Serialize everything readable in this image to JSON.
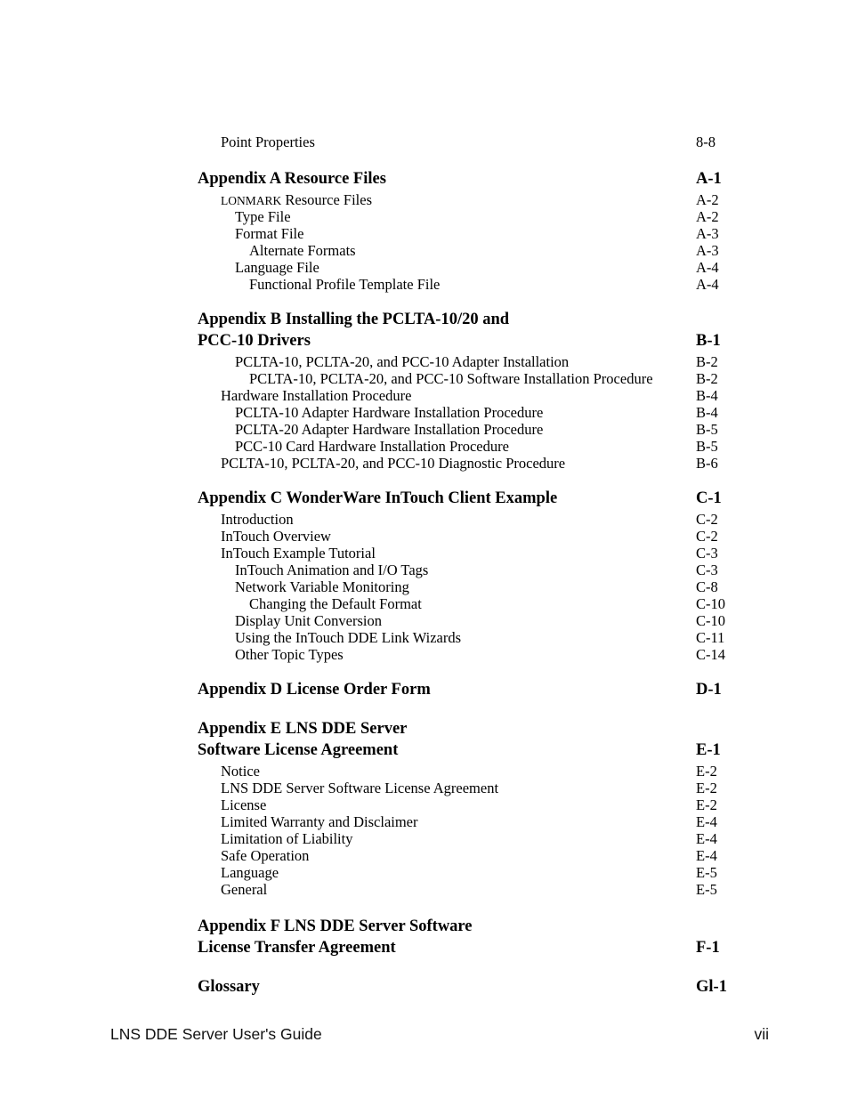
{
  "document": {
    "footer_left": "LNS DDE Server User's Guide",
    "footer_right": "vii"
  },
  "toc": {
    "entries": [
      {
        "level": 1,
        "type": "entry",
        "label": "Point Properties",
        "page": "8-8",
        "gap_before": 0
      },
      {
        "level": 0,
        "type": "head",
        "label": "Appendix A  Resource Files",
        "page": "A-1",
        "gap_before": 20
      },
      {
        "level": 1,
        "type": "entry",
        "label": "LONMARK Resource Files",
        "page": "A-2",
        "gap_before": 2,
        "smallcaps_prefix": "LONMARK",
        "rest": " Resource Files"
      },
      {
        "level": 2,
        "type": "entry",
        "label": "Type File",
        "page": "A-2",
        "gap_before": 0
      },
      {
        "level": 2,
        "type": "entry",
        "label": "Format File",
        "page": "A-3",
        "gap_before": 0
      },
      {
        "level": 3,
        "type": "entry",
        "label": "Alternate Formats",
        "page": "A-3",
        "gap_before": 0
      },
      {
        "level": 2,
        "type": "entry",
        "label": "Language File",
        "page": "A-4",
        "gap_before": 0
      },
      {
        "level": 3,
        "type": "entry",
        "label": "Functional Profile Template File",
        "page": "A-4",
        "gap_before": 0
      },
      {
        "level": 0,
        "type": "head",
        "label": "Appendix B Installing the PCLTA-10/20 and",
        "page": "",
        "gap_before": 18
      },
      {
        "level": 0,
        "type": "head",
        "label": "PCC-10 Drivers",
        "page": "B-1",
        "gap_before": 0
      },
      {
        "level": 2,
        "type": "entry",
        "label": "PCLTA-10, PCLTA-20, and PCC-10 Adapter Installation",
        "page": "B-2",
        "gap_before": 2
      },
      {
        "level": 3,
        "type": "entry",
        "label": "PCLTA-10, PCLTA-20, and PCC-10 Software Installation Procedure",
        "page": "B-2",
        "gap_before": 0
      },
      {
        "level": 1,
        "type": "entry",
        "label": "Hardware Installation Procedure",
        "page": "B-4",
        "gap_before": 0
      },
      {
        "level": 2,
        "type": "entry",
        "label": "PCLTA-10 Adapter Hardware Installation Procedure",
        "page": "B-4",
        "gap_before": 0
      },
      {
        "level": 2,
        "type": "entry",
        "label": "PCLTA-20 Adapter Hardware Installation Procedure",
        "page": "B-5",
        "gap_before": 0
      },
      {
        "level": 2,
        "type": "entry",
        "label": "PCC-10 Card Hardware Installation Procedure",
        "page": "B-5",
        "gap_before": 0
      },
      {
        "level": 1,
        "type": "entry",
        "label": "PCLTA-10, PCLTA-20, and PCC-10 Diagnostic Procedure",
        "page": "B-6",
        "gap_before": 0
      },
      {
        "level": 0,
        "type": "head",
        "label": "Appendix C  WonderWare InTouch Client Example",
        "page": "C-1",
        "gap_before": 18
      },
      {
        "level": 1,
        "type": "entry",
        "label": "Introduction",
        "page": "C-2",
        "gap_before": 2
      },
      {
        "level": 1,
        "type": "entry",
        "label": "InTouch Overview",
        "page": "C-2",
        "gap_before": 0
      },
      {
        "level": 1,
        "type": "entry",
        "label": "InTouch Example Tutorial",
        "page": "C-3",
        "gap_before": 0
      },
      {
        "level": 2,
        "type": "entry",
        "label": "InTouch Animation and I/O Tags",
        "page": "C-3",
        "gap_before": 0
      },
      {
        "level": 2,
        "type": "entry",
        "label": "Network Variable Monitoring",
        "page": "C-8",
        "gap_before": 0
      },
      {
        "level": 3,
        "type": "entry",
        "label": "Changing the Default Format",
        "page": "C-10",
        "gap_before": 0
      },
      {
        "level": 2,
        "type": "entry",
        "label": "Display Unit Conversion",
        "page": "C-10",
        "gap_before": 0
      },
      {
        "level": 2,
        "type": "entry",
        "label": "Using the InTouch DDE Link Wizards",
        "page": "C-11",
        "gap_before": 0
      },
      {
        "level": 2,
        "type": "entry",
        "label": "Other Topic Types",
        "page": "C-14",
        "gap_before": 0
      },
      {
        "level": 0,
        "type": "head",
        "label": "Appendix D License Order Form",
        "page": "D-1",
        "gap_before": 18
      },
      {
        "level": 0,
        "type": "head",
        "label": "Appendix E LNS DDE Server",
        "page": "",
        "gap_before": 20
      },
      {
        "level": 0,
        "type": "head",
        "label": "Software License Agreement",
        "page": "E-1",
        "gap_before": 0
      },
      {
        "level": 1,
        "type": "entry",
        "label": "Notice",
        "page": "E-2",
        "gap_before": 2
      },
      {
        "level": 1,
        "type": "entry",
        "label": "LNS DDE Server Software License Agreement",
        "page": "E-2",
        "gap_before": 0
      },
      {
        "level": 1,
        "type": "entry",
        "label": "License",
        "page": "E-2",
        "gap_before": 0
      },
      {
        "level": 1,
        "type": "entry",
        "label": "Limited Warranty and Disclaimer",
        "page": "E-4",
        "gap_before": 0
      },
      {
        "level": 1,
        "type": "entry",
        "label": "Limitation of Liability",
        "page": "E-4",
        "gap_before": 0
      },
      {
        "level": 1,
        "type": "entry",
        "label": "Safe Operation",
        "page": "E-4",
        "gap_before": 0
      },
      {
        "level": 1,
        "type": "entry",
        "label": "Language",
        "page": "E-5",
        "gap_before": 0
      },
      {
        "level": 1,
        "type": "entry",
        "label": "General",
        "page": "E-5",
        "gap_before": 0
      },
      {
        "level": 0,
        "type": "head",
        "label": "Appendix F LNS DDE Server Software",
        "page": "",
        "gap_before": 20
      },
      {
        "level": 0,
        "type": "head",
        "label": "License Transfer Agreement",
        "page": "F-1",
        "gap_before": 0
      },
      {
        "level": 0,
        "type": "head",
        "label": "Glossary",
        "page": "Gl-1",
        "gap_before": 20
      }
    ]
  }
}
